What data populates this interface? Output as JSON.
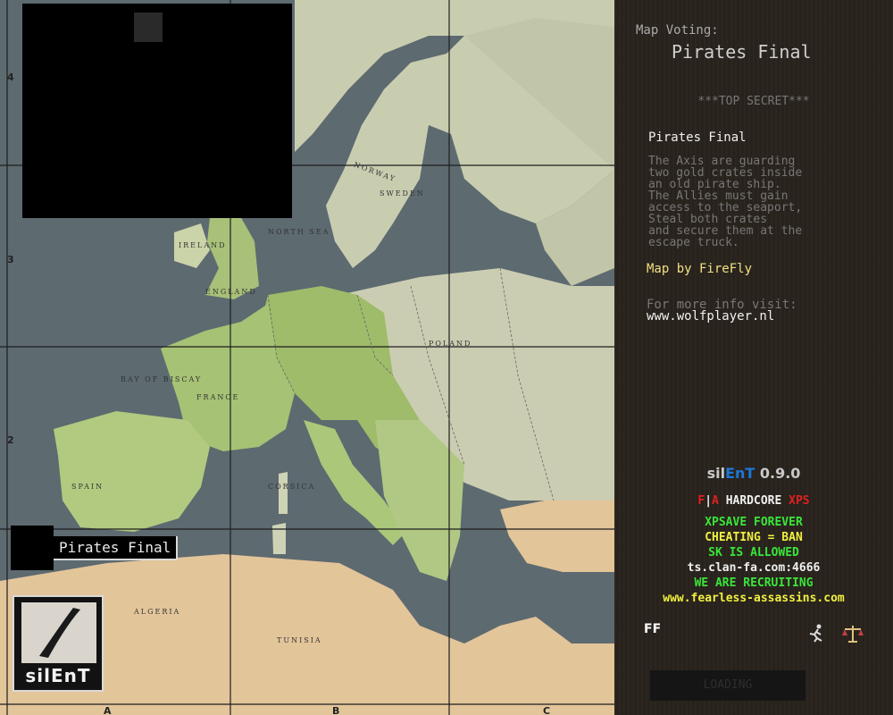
{
  "map": {
    "grid_rows": [
      "4",
      "3",
      "2"
    ],
    "grid_cols": [
      "A",
      "B",
      "C"
    ],
    "countries": [
      "NORWAY",
      "SWEDEN",
      "NORTH SEA",
      "IRELAND",
      "ENGLAND",
      "BAY OF BISCAY",
      "FRANCE",
      "SPAIN",
      "POLAND",
      "CORSICA",
      "ALGERIA",
      "TUNISIA"
    ]
  },
  "map_label": {
    "name": "Pirates Final"
  },
  "logo": {
    "text": "silEnT"
  },
  "voting": {
    "label": "Map Voting:",
    "title": "Pirates Final"
  },
  "briefing": {
    "classification": "***TOP SECRET***",
    "title": "Pirates Final",
    "body": "The Axis are guarding\ntwo gold crates inside\nan old pirate ship.\nThe Allies must gain\naccess to the seaport,\nSteal both crates\nand secure them at the\nescape truck.",
    "map_by": "Map by FireFly",
    "info_label": "For more info visit:",
    "info_url": "www.wolfplayer.nl"
  },
  "server": {
    "name_prefix": "sil",
    "name_highlight": "EnT",
    "version": "0.9.0",
    "mode_f": "F",
    "mode_sep": "|",
    "mode_a": "A",
    "mode_hardcore": "HARDCORE",
    "mode_xps": "XPS",
    "lines": [
      {
        "text": "XPSAVE FOREVER",
        "color": "green"
      },
      {
        "text": "CHEATING = BAN",
        "color": "yellow"
      },
      {
        "text": "SK IS ALLOWED",
        "color": "green"
      },
      {
        "text": "ts.clan-fa.com:4666",
        "color": "white"
      },
      {
        "text": "WE ARE RECRUITING",
        "color": "green"
      },
      {
        "text": "www.fearless-assassins.com",
        "color": "yellow"
      }
    ],
    "ff_icon": "FF"
  },
  "icons": {
    "ff": "ff-logo-icon",
    "runner": "runner-icon",
    "scales": "scales-icon"
  },
  "loading": {
    "label": "LOADING"
  }
}
